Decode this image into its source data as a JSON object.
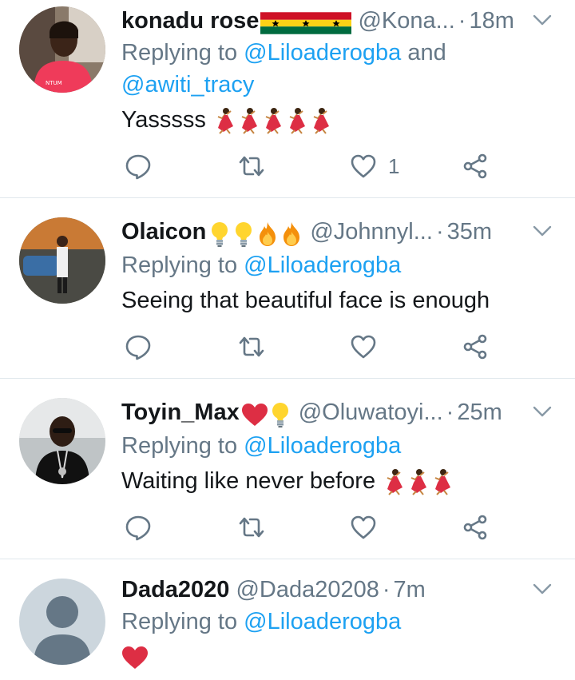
{
  "tweets": [
    {
      "name": "konadu rose",
      "name_emojis": [
        "ghana-flag",
        "ghana-flag",
        "ghana-flag"
      ],
      "handle": "@Kona...",
      "time": "18m",
      "reply_prefix": "Replying to",
      "mention_1": "@Liloaderogba",
      "reply_and": "and",
      "mention_2": "@awiti_tracy",
      "text": "Yasssss",
      "text_emojis": [
        "dancer",
        "dancer",
        "dancer",
        "dancer",
        "dancer"
      ],
      "likes": "1"
    },
    {
      "name": "Olaicon",
      "name_emojis": [
        "light-bulb",
        "light-bulb",
        "fire",
        "fire"
      ],
      "handle": "@Johnnyl...",
      "time": "35m",
      "reply_prefix": "Replying to",
      "mention_1": "@Liloaderogba",
      "text": "Seeing that beautiful face is enough",
      "text_emojis": []
    },
    {
      "name": "Toyin_Max",
      "name_emojis": [
        "red-heart",
        "light-bulb"
      ],
      "handle": "@Oluwatoyi...",
      "time": "25m",
      "reply_prefix": "Replying to",
      "mention_1": "@Liloaderogba",
      "text": "Waiting like never before",
      "text_emojis": [
        "dancer",
        "dancer",
        "dancer"
      ]
    },
    {
      "name": "Dada2020",
      "name_emojis": [],
      "handle": "@Dada20208",
      "time": "7m",
      "reply_prefix": "Replying to",
      "mention_1": "@Liloaderogba",
      "text": "",
      "text_emojis": [
        "red-heart"
      ]
    }
  ],
  "colors": {
    "name": "#14171a",
    "secondary": "#657786",
    "mention": "#1da1f2",
    "divider": "#e1e8ed",
    "heart": "#e0245e"
  }
}
